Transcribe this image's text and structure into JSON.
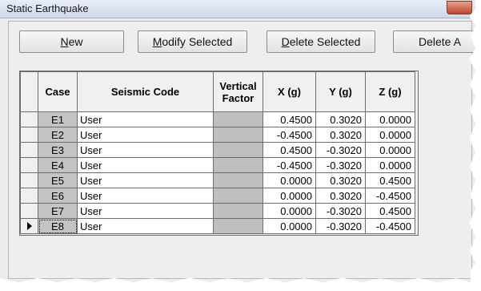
{
  "window": {
    "title": "Static Earthquake"
  },
  "toolbar": {
    "new": {
      "accel": "N",
      "rest": "ew"
    },
    "modify": {
      "accel": "M",
      "rest": "odify Selected"
    },
    "delete": {
      "accel": "D",
      "rest": "elete Selected"
    },
    "delete_all": "Delete A"
  },
  "grid": {
    "headers": {
      "case": "Case",
      "code": "Seismic Code",
      "vf_line1": "Vertical",
      "vf_line2": "Factor",
      "x": "X (g)",
      "y": "Y (g)",
      "z": "Z (g)"
    },
    "rows": [
      {
        "case": "E1",
        "code": "User",
        "vf": "",
        "x": "0.4500",
        "y": "0.3020",
        "z": "0.0000"
      },
      {
        "case": "E2",
        "code": "User",
        "vf": "",
        "x": "-0.4500",
        "y": "0.3020",
        "z": "0.0000"
      },
      {
        "case": "E3",
        "code": "User",
        "vf": "",
        "x": "0.4500",
        "y": "-0.3020",
        "z": "0.0000"
      },
      {
        "case": "E4",
        "code": "User",
        "vf": "",
        "x": "-0.4500",
        "y": "-0.3020",
        "z": "0.0000"
      },
      {
        "case": "E5",
        "code": "User",
        "vf": "",
        "x": "0.0000",
        "y": "0.3020",
        "z": "0.4500"
      },
      {
        "case": "E6",
        "code": "User",
        "vf": "",
        "x": "0.0000",
        "y": "0.3020",
        "z": "-0.4500"
      },
      {
        "case": "E7",
        "code": "User",
        "vf": "",
        "x": "0.0000",
        "y": "-0.3020",
        "z": "0.4500"
      },
      {
        "case": "E8",
        "code": "User",
        "vf": "",
        "x": "0.0000",
        "y": "-0.3020",
        "z": "-0.4500"
      }
    ],
    "current_row_index": 7,
    "current_row_icon": "row-pointer-arrow-icon"
  }
}
